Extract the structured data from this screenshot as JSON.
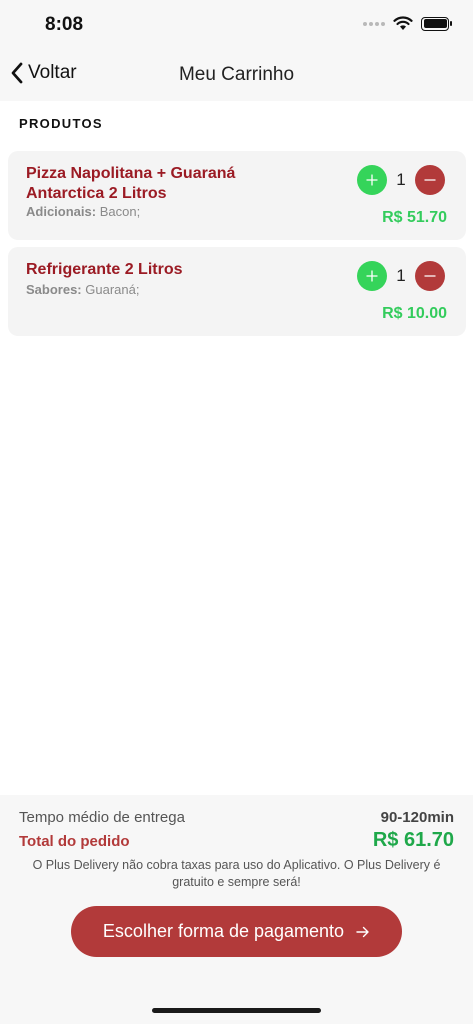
{
  "status_bar": {
    "time": "8:08",
    "icons": [
      "signal-dots-icon",
      "wifi-icon",
      "battery-icon"
    ]
  },
  "nav": {
    "back_label": "Voltar",
    "back_icon": "chevron-left-icon",
    "title": "Meu Carrinho"
  },
  "section_title": "PRODUTOS",
  "items": [
    {
      "name": "Pizza Napolitana + Guaraná Antarctica 2 Litros",
      "detail_key": "Adicionais:",
      "detail_value": "Bacon;",
      "quantity": "1",
      "price": "R$ 51.70"
    },
    {
      "name": "Refrigerante 2 Litros",
      "detail_key": "Sabores:",
      "detail_value": "Guaraná;",
      "quantity": "1",
      "price": "R$ 10.00"
    }
  ],
  "summary": {
    "delivery_label": "Tempo médio de entrega",
    "delivery_value": "90-120min",
    "total_label": "Total do pedido",
    "total_value": "R$ 61.70",
    "info": "O Plus Delivery não cobra taxas para uso do Aplicativo. O Plus Delivery é gratuito e sempre será!"
  },
  "pay_button": {
    "label": "Escolher forma de pagamento",
    "icon": "arrow-right-icon"
  },
  "colors": {
    "accent_red": "#b23a3a",
    "item_name_red": "#9b1b24",
    "plus_green": "#35d45a",
    "price_green": "#33cc5c",
    "total_green": "#1fa84a"
  }
}
